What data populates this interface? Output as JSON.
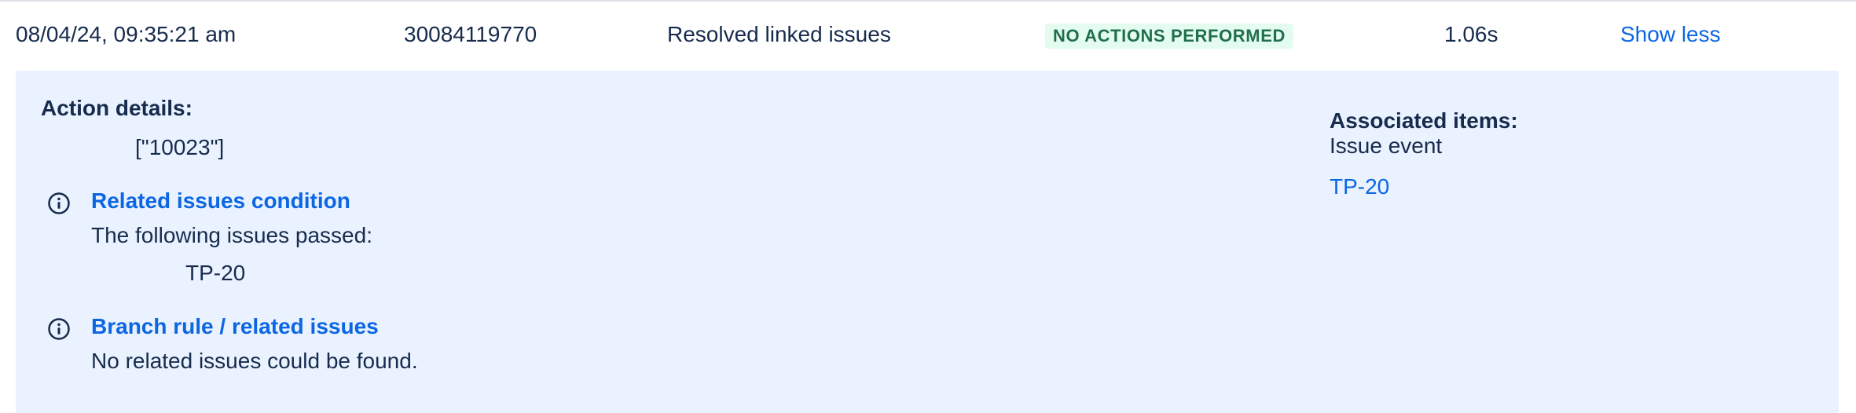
{
  "row": {
    "date": "08/04/24, 09:35:21 am",
    "id": "30084119770",
    "rule_name": "Resolved linked issues",
    "status": "NO ACTIONS PERFORMED",
    "duration": "1.06s",
    "toggle_label": "Show less"
  },
  "details": {
    "action_details_label": "Action details:",
    "action_value": "[\"10023\"]",
    "entries": [
      {
        "icon": "info-icon",
        "title": "Related issues condition",
        "text": "The following issues passed:",
        "value": "TP-20"
      },
      {
        "icon": "info-icon",
        "title": "Branch rule / related issues",
        "text": "No related issues could be found."
      }
    ],
    "associated": {
      "label": "Associated items:",
      "event": "Issue event",
      "item_link": "TP-20"
    }
  },
  "colors": {
    "accent_link": "#0c66e4",
    "panel_bg": "#e9f2fe",
    "status_bg": "#e3fcef",
    "status_text": "#216e4e"
  }
}
